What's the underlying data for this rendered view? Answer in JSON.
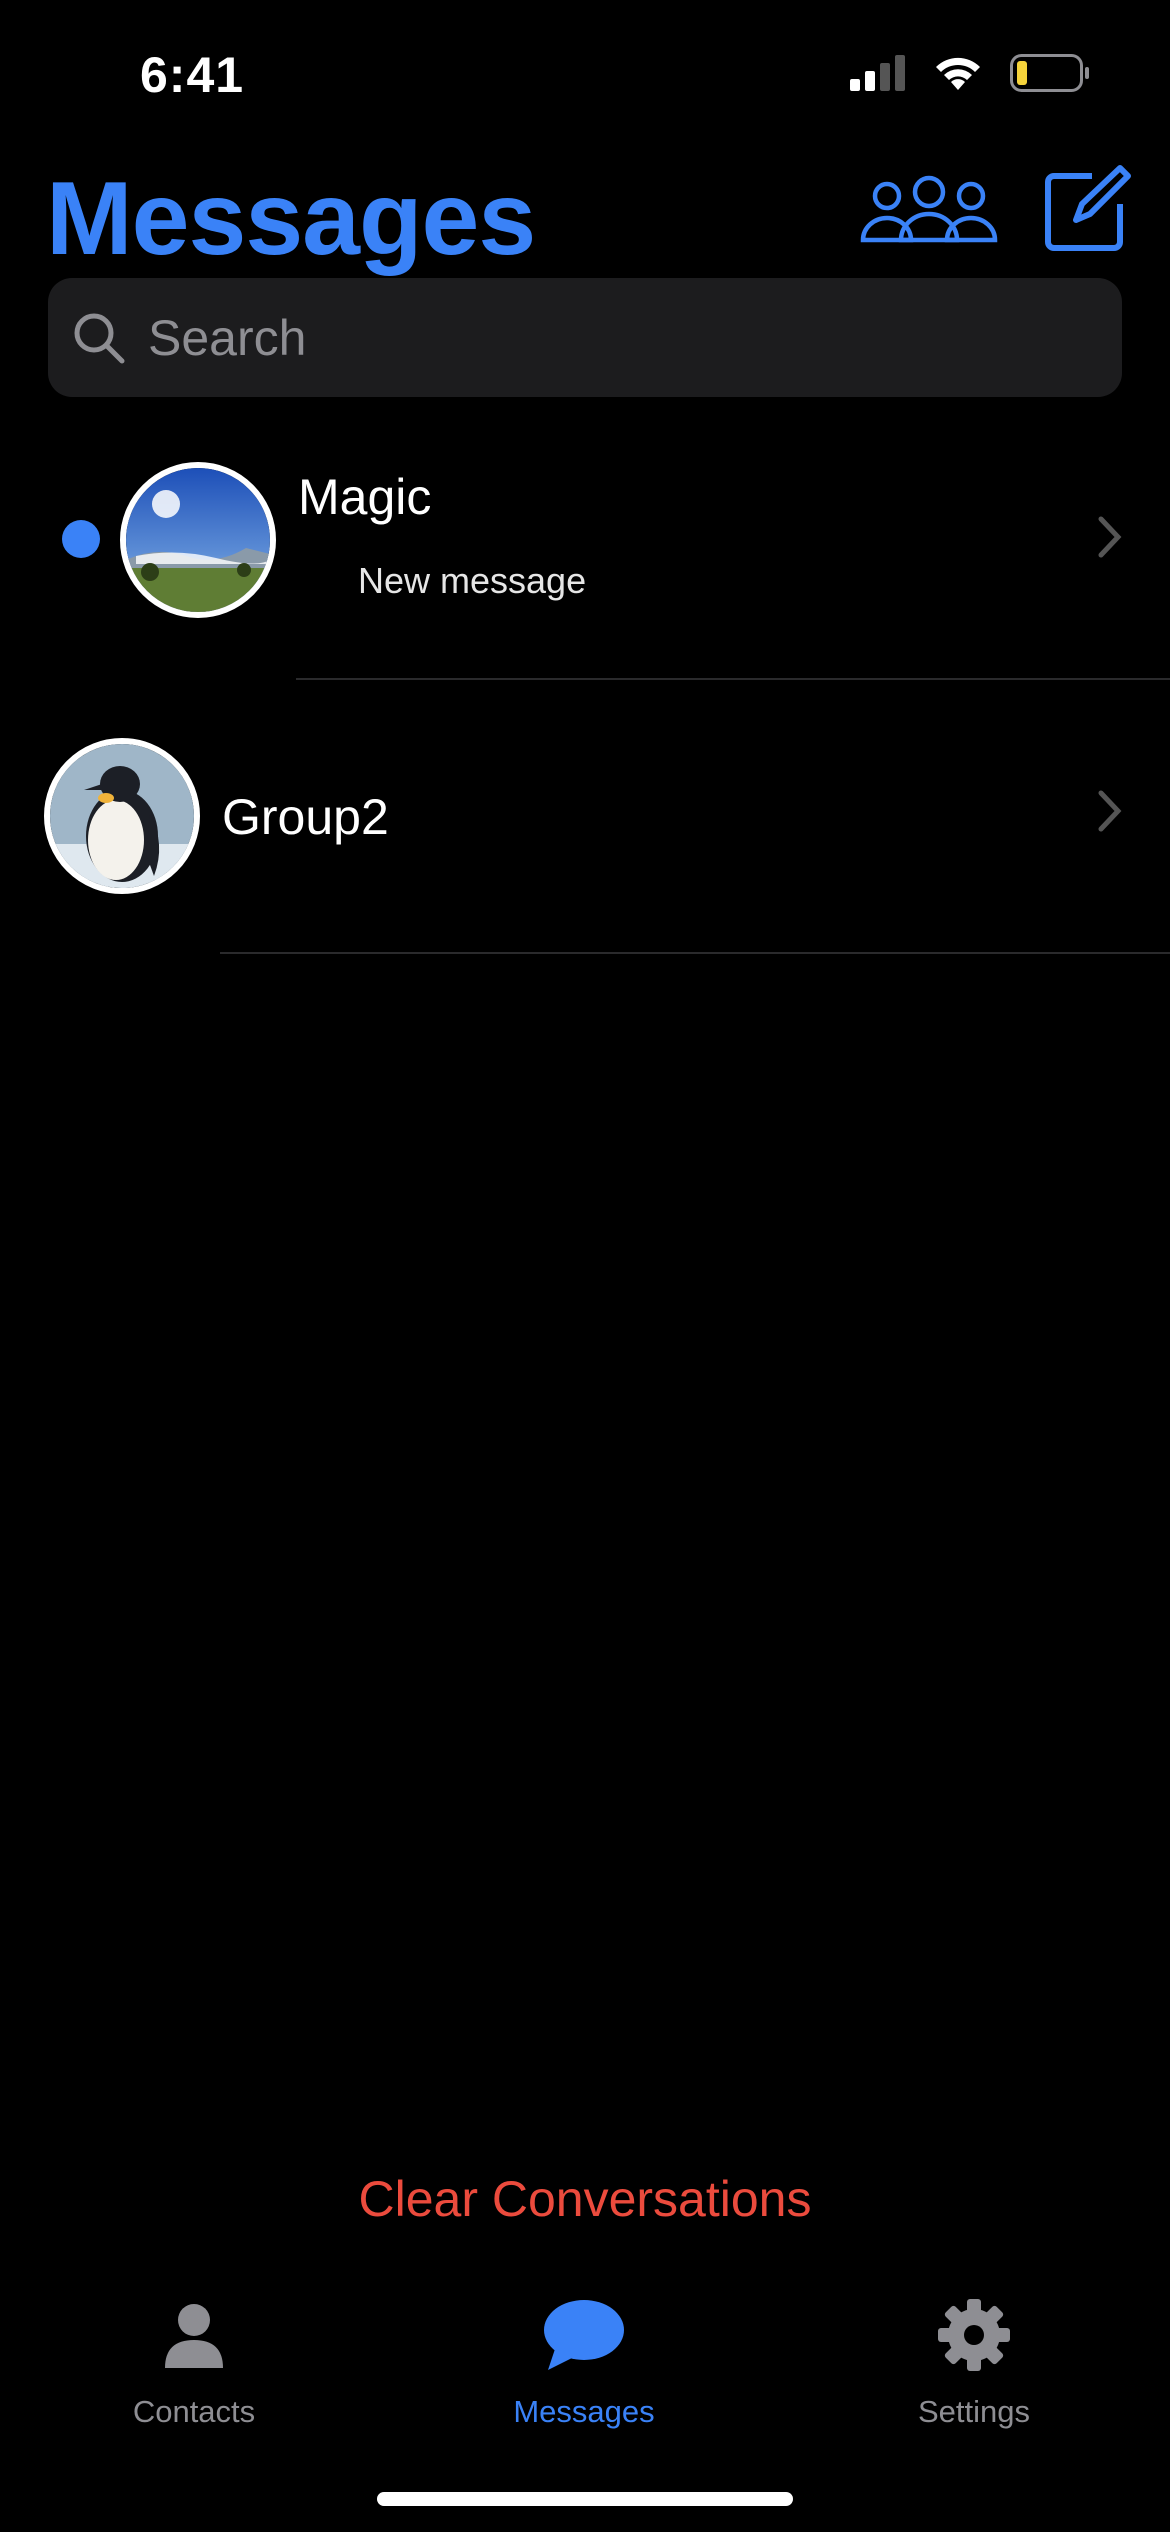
{
  "status_bar": {
    "time": "6:41",
    "battery_color": "#f5d33b"
  },
  "header": {
    "title": "Messages",
    "group_icon": "people-icon",
    "compose_icon": "compose-icon"
  },
  "search": {
    "placeholder": "Search",
    "value": ""
  },
  "conversations": [
    {
      "name": "Magic",
      "preview": "New message",
      "unread": true,
      "avatar": "landscape-avatar"
    },
    {
      "name": "Group2",
      "preview": "",
      "unread": false,
      "avatar": "penguin-avatar"
    }
  ],
  "actions": {
    "clear_label": "Clear Conversations"
  },
  "tabbar": {
    "items": [
      {
        "label": "Contacts",
        "icon": "person-icon",
        "active": false
      },
      {
        "label": "Messages",
        "icon": "chat-bubble-icon",
        "active": true
      },
      {
        "label": "Settings",
        "icon": "gear-icon",
        "active": false
      }
    ]
  },
  "colors": {
    "accent": "#3a82f7",
    "destructive": "#eb4b3d",
    "inactive": "#8e8e93"
  }
}
